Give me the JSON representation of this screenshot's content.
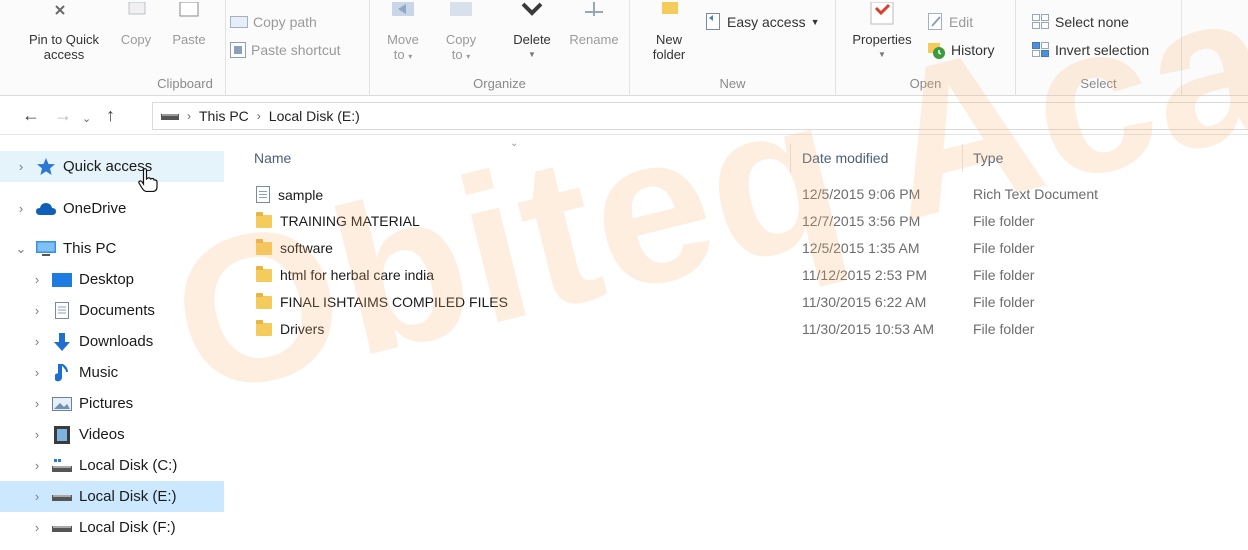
{
  "ribbon": {
    "clipboard": {
      "label": "Clipboard",
      "pin_label_1": "Pin to Quick",
      "pin_label_2": "access",
      "copy_label": "Copy",
      "paste_label": "Paste",
      "copy_path_label": "Copy path",
      "paste_shortcut_label": "Paste shortcut"
    },
    "organize": {
      "label": "Organize",
      "move_label_1": "Move",
      "move_label_2": "to",
      "copyto_label_1": "Copy",
      "copyto_label_2": "to",
      "delete_label": "Delete",
      "rename_label": "Rename"
    },
    "new": {
      "label": "New",
      "new_folder_label_1": "New",
      "new_folder_label_2": "folder",
      "easy_access_label": "Easy access"
    },
    "open": {
      "label": "Open",
      "properties_label": "Properties",
      "edit_label": "Edit",
      "history_label": "History"
    },
    "select": {
      "label": "Select",
      "select_none_label": "Select none",
      "invert_label": "Invert selection"
    }
  },
  "address": {
    "crumbs": [
      "This PC",
      "Local Disk (E:)"
    ]
  },
  "navpane": {
    "items": [
      {
        "label": "Quick access",
        "icon": "star-icon"
      },
      {
        "label": "OneDrive",
        "icon": "cloud-icon"
      },
      {
        "label": "This PC",
        "icon": "computer-icon"
      },
      {
        "label": "Desktop",
        "icon": "desktop-icon"
      },
      {
        "label": "Documents",
        "icon": "documents-icon"
      },
      {
        "label": "Downloads",
        "icon": "download-icon"
      },
      {
        "label": "Music",
        "icon": "music-icon"
      },
      {
        "label": "Pictures",
        "icon": "pictures-icon"
      },
      {
        "label": "Videos",
        "icon": "videos-icon"
      },
      {
        "label": "Local Disk (C:)",
        "icon": "drive-icon"
      },
      {
        "label": "Local Disk (E:)",
        "icon": "drive-icon"
      },
      {
        "label": "Local Disk (F:)",
        "icon": "drive-icon"
      }
    ]
  },
  "filelist": {
    "columns": {
      "name": "Name",
      "date": "Date modified",
      "type": "Type"
    },
    "rows": [
      {
        "name": "sample",
        "date": "12/5/2015 9:06 PM",
        "type": "Rich Text Document",
        "icon": "document-icon"
      },
      {
        "name": "TRAINING MATERIAL",
        "date": "12/7/2015 3:56 PM",
        "type": "File folder",
        "icon": "folder-icon"
      },
      {
        "name": "software",
        "date": "12/5/2015 1:35 AM",
        "type": "File folder",
        "icon": "folder-icon"
      },
      {
        "name": "html for herbal care india",
        "date": "11/12/2015 2:53 PM",
        "type": "File folder",
        "icon": "folder-icon"
      },
      {
        "name": "FINAL ISHTAIMS COMPILED FILES",
        "date": "11/30/2015 6:22 AM",
        "type": "File folder",
        "icon": "folder-icon"
      },
      {
        "name": "Drivers",
        "date": "11/30/2015 10:53 AM",
        "type": "File folder",
        "icon": "folder-icon"
      }
    ]
  },
  "watermark": {
    "text": "Obiteq Acade"
  }
}
